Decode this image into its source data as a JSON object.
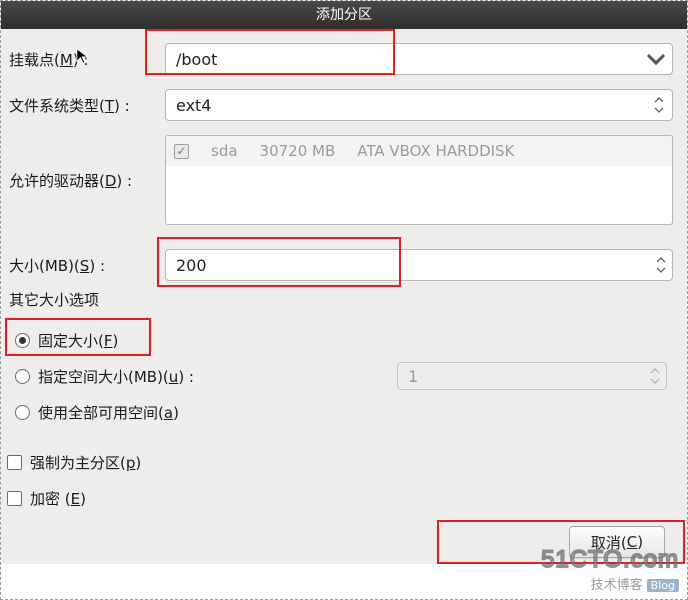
{
  "title": "添加分区",
  "labels": {
    "mount_point": "挂载点(",
    "mount_point_u": "M",
    "mount_point_end": ") :",
    "fs_type": "文件系统类型(",
    "fs_type_u": "T",
    "fs_type_end": ") :",
    "allowed_drives": "允许的驱动器(",
    "allowed_drives_u": "D",
    "allowed_drives_end": ") :",
    "size": "大小(MB)(",
    "size_u": "S",
    "size_end": ") :",
    "other_size": "其它大小选项"
  },
  "fields": {
    "mount_point": "/boot",
    "fs_type": "ext4",
    "size": "200",
    "max_size": "1"
  },
  "drives": {
    "name": "sda",
    "size": "30720 MB",
    "model": "ATA VBOX HARDDISK",
    "checked": true
  },
  "options": {
    "fixed": "固定大小(",
    "fixed_u": "F",
    "fixed_end": ")",
    "upto": "指定空间大小(MB)(",
    "upto_u": "u",
    "upto_end": ") :",
    "fill": "使用全部可用空间(",
    "fill_u": "a",
    "fill_end": ")",
    "selected": "fixed",
    "force_primary_pre": "强制为主分区(",
    "force_primary_u": "p",
    "force_primary_end": ")",
    "encrypt_pre": "加密  (",
    "encrypt_u": "E",
    "encrypt_end": ")"
  },
  "buttons": {
    "cancel": "取消(",
    "cancel_u": "C",
    "cancel_end": ")"
  },
  "watermark": {
    "l1": "51CTO.com",
    "l2": "技术博客",
    "tag": "Blog"
  }
}
